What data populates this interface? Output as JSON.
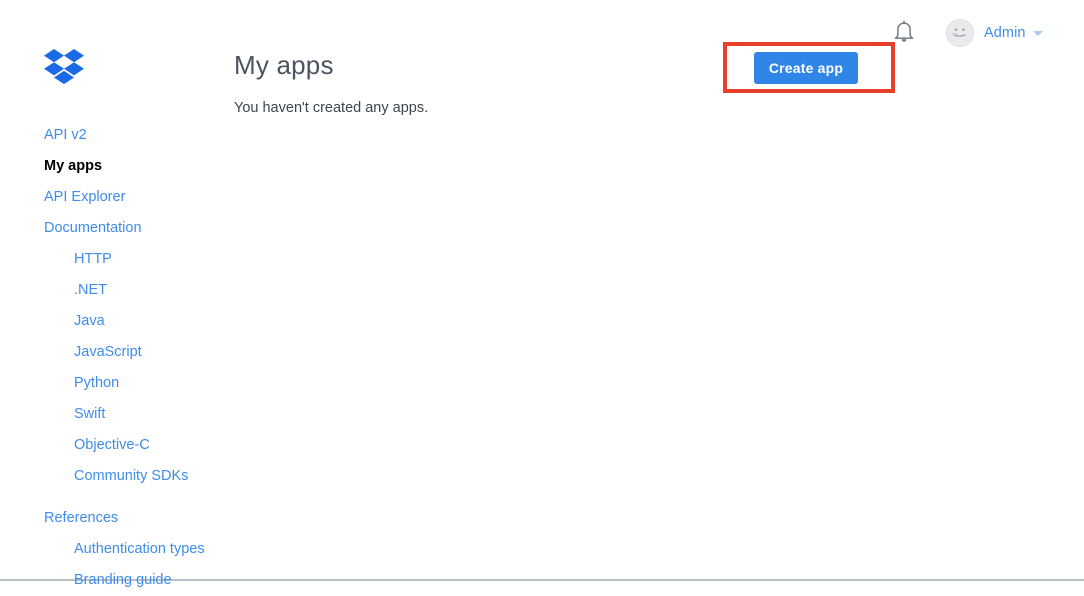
{
  "topbar": {
    "notifications_icon": "bell-icon",
    "user": {
      "name": "Admin",
      "avatar_icon": "user-avatar-face-icon",
      "caret_icon": "chevron-down-icon"
    }
  },
  "sidebar": {
    "logo_icon": "dropbox-logo-icon",
    "items": [
      {
        "label": "API v2",
        "indent": false,
        "active": false
      },
      {
        "label": "My apps",
        "indent": false,
        "active": true
      },
      {
        "label": "API Explorer",
        "indent": false,
        "active": false
      },
      {
        "label": "Documentation",
        "indent": false,
        "active": false
      },
      {
        "label": "HTTP",
        "indent": true,
        "active": false
      },
      {
        "label": ".NET",
        "indent": true,
        "active": false
      },
      {
        "label": "Java",
        "indent": true,
        "active": false
      },
      {
        "label": "JavaScript",
        "indent": true,
        "active": false
      },
      {
        "label": "Python",
        "indent": true,
        "active": false
      },
      {
        "label": "Swift",
        "indent": true,
        "active": false
      },
      {
        "label": "Objective-C",
        "indent": true,
        "active": false
      },
      {
        "label": "Community SDKs",
        "indent": true,
        "active": false
      },
      {
        "label": "References",
        "indent": false,
        "active": false
      },
      {
        "label": "Authentication types",
        "indent": true,
        "active": false
      },
      {
        "label": "Branding guide",
        "indent": true,
        "active": false
      }
    ]
  },
  "main": {
    "title": "My apps",
    "empty_message": "You haven't created any apps.",
    "create_app_label": "Create app"
  },
  "colors": {
    "link_blue": "#3f8cea",
    "button_blue": "#3086e6",
    "annotation_red": "#e8402a",
    "logo_blue": "#1a6ae8",
    "title_gray": "#4b5560"
  }
}
